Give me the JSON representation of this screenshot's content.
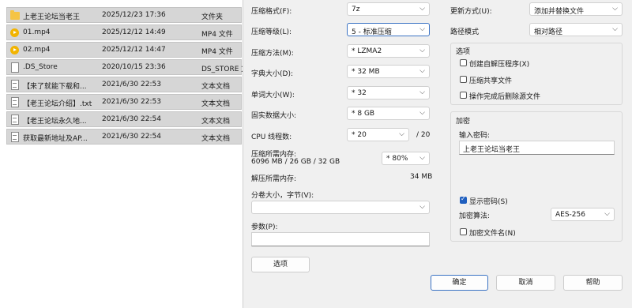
{
  "files": [
    {
      "icon": "folder-icon",
      "name": "上老王论坛当老王",
      "date": "2025/12/23 17:36",
      "type": "文件夹"
    },
    {
      "icon": "media-file-icon",
      "name": "01.mp4",
      "date": "2025/12/12 14:49",
      "type": "MP4 文件"
    },
    {
      "icon": "media-file-icon",
      "name": "02.mp4",
      "date": "2025/12/12 14:47",
      "type": "MP4 文件"
    },
    {
      "icon": "blank-file-icon",
      "name": ".DS_Store",
      "date": "2020/10/15 23:36",
      "type": "DS_STORE 文"
    },
    {
      "icon": "text-file-icon",
      "name": "【来了就能下载和...",
      "date": "2021/6/30 22:53",
      "type": "文本文档"
    },
    {
      "icon": "text-file-icon",
      "name": "【老王论坛介绍】.txt",
      "date": "2021/6/30 22:53",
      "type": "文本文档"
    },
    {
      "icon": "text-file-icon",
      "name": "【老王论坛永久地...",
      "date": "2021/6/30 22:54",
      "type": "文本文档"
    },
    {
      "icon": "text-file-icon",
      "name": "获取最新地址及AP...",
      "date": "2021/6/30 22:54",
      "type": "文本文档"
    }
  ],
  "dialog": {
    "format": {
      "label": "压缩格式(F):",
      "value": "7z"
    },
    "level": {
      "label": "压缩等级(L):",
      "value": "5 - 标准压缩"
    },
    "method": {
      "label": "压缩方法(M):",
      "value": "* LZMA2"
    },
    "dict": {
      "label": "字典大小(D):",
      "value": "* 32 MB"
    },
    "word": {
      "label": "单词大小(W):",
      "value": "* 32"
    },
    "solid": {
      "label": "固实数据大小:",
      "value": "* 8 GB"
    },
    "cpu": {
      "label": "CPU 线程数:",
      "value": "* 20",
      "max": "/ 20"
    },
    "mem_compress": {
      "label": "压缩所需内存:",
      "detail": "6096 MB / 26 GB / 32 GB",
      "value": "* 80%"
    },
    "mem_decompress": {
      "label": "解压所需内存:",
      "value": "34 MB"
    },
    "volume": {
      "label": "分卷大小，字节(V):",
      "value": ""
    },
    "params": {
      "label": "参数(P):",
      "value": ""
    },
    "options_button": "选项",
    "update_mode": {
      "label": "更新方式(U):",
      "value": "添加并替换文件"
    },
    "path_mode": {
      "label": "路径模式",
      "value": "相对路径"
    },
    "options_group": {
      "title": "选项",
      "sfx": "创建自解压程序(X)",
      "shared": "压缩共享文件",
      "delete_after": "操作完成后删除源文件"
    },
    "encryption": {
      "title": "加密",
      "password_label": "输入密码:",
      "password": "上老王论坛当老王",
      "show_password": "显示密码(S)",
      "method_label": "加密算法:",
      "method": "AES-256",
      "encrypt_names": "加密文件名(N)"
    },
    "buttons": {
      "ok": "确定",
      "cancel": "取消",
      "help": "帮助"
    }
  }
}
